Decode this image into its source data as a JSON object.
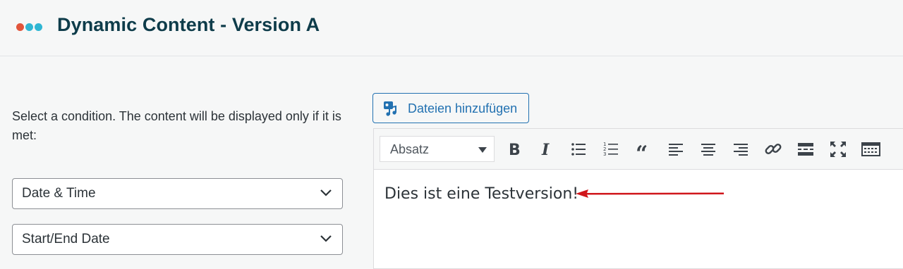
{
  "header": {
    "title": "Dynamic Content - Version A",
    "logo_colors": [
      "#e1553b",
      "#2fb6d3",
      "#2fb6d3"
    ]
  },
  "condition": {
    "description": "Select a condition. The content will be displayed only if it is met:",
    "type_select": "Date & Time",
    "mode_select": "Start/End Date"
  },
  "editor": {
    "add_files_label": "Dateien hinzufügen",
    "format_select": "Absatz",
    "toolbar_icons": [
      "bold-icon",
      "italic-icon",
      "bullet-list-icon",
      "numbered-list-icon",
      "blockquote-icon",
      "align-left-icon",
      "align-center-icon",
      "align-right-icon",
      "link-icon",
      "read-more-icon",
      "fullscreen-icon",
      "toolbar-toggle-icon"
    ],
    "content_text": "Dies ist eine Testversion!"
  },
  "colors": {
    "accent": "#2271b1",
    "title": "#0e3c4a",
    "arrow": "#d0161b"
  }
}
